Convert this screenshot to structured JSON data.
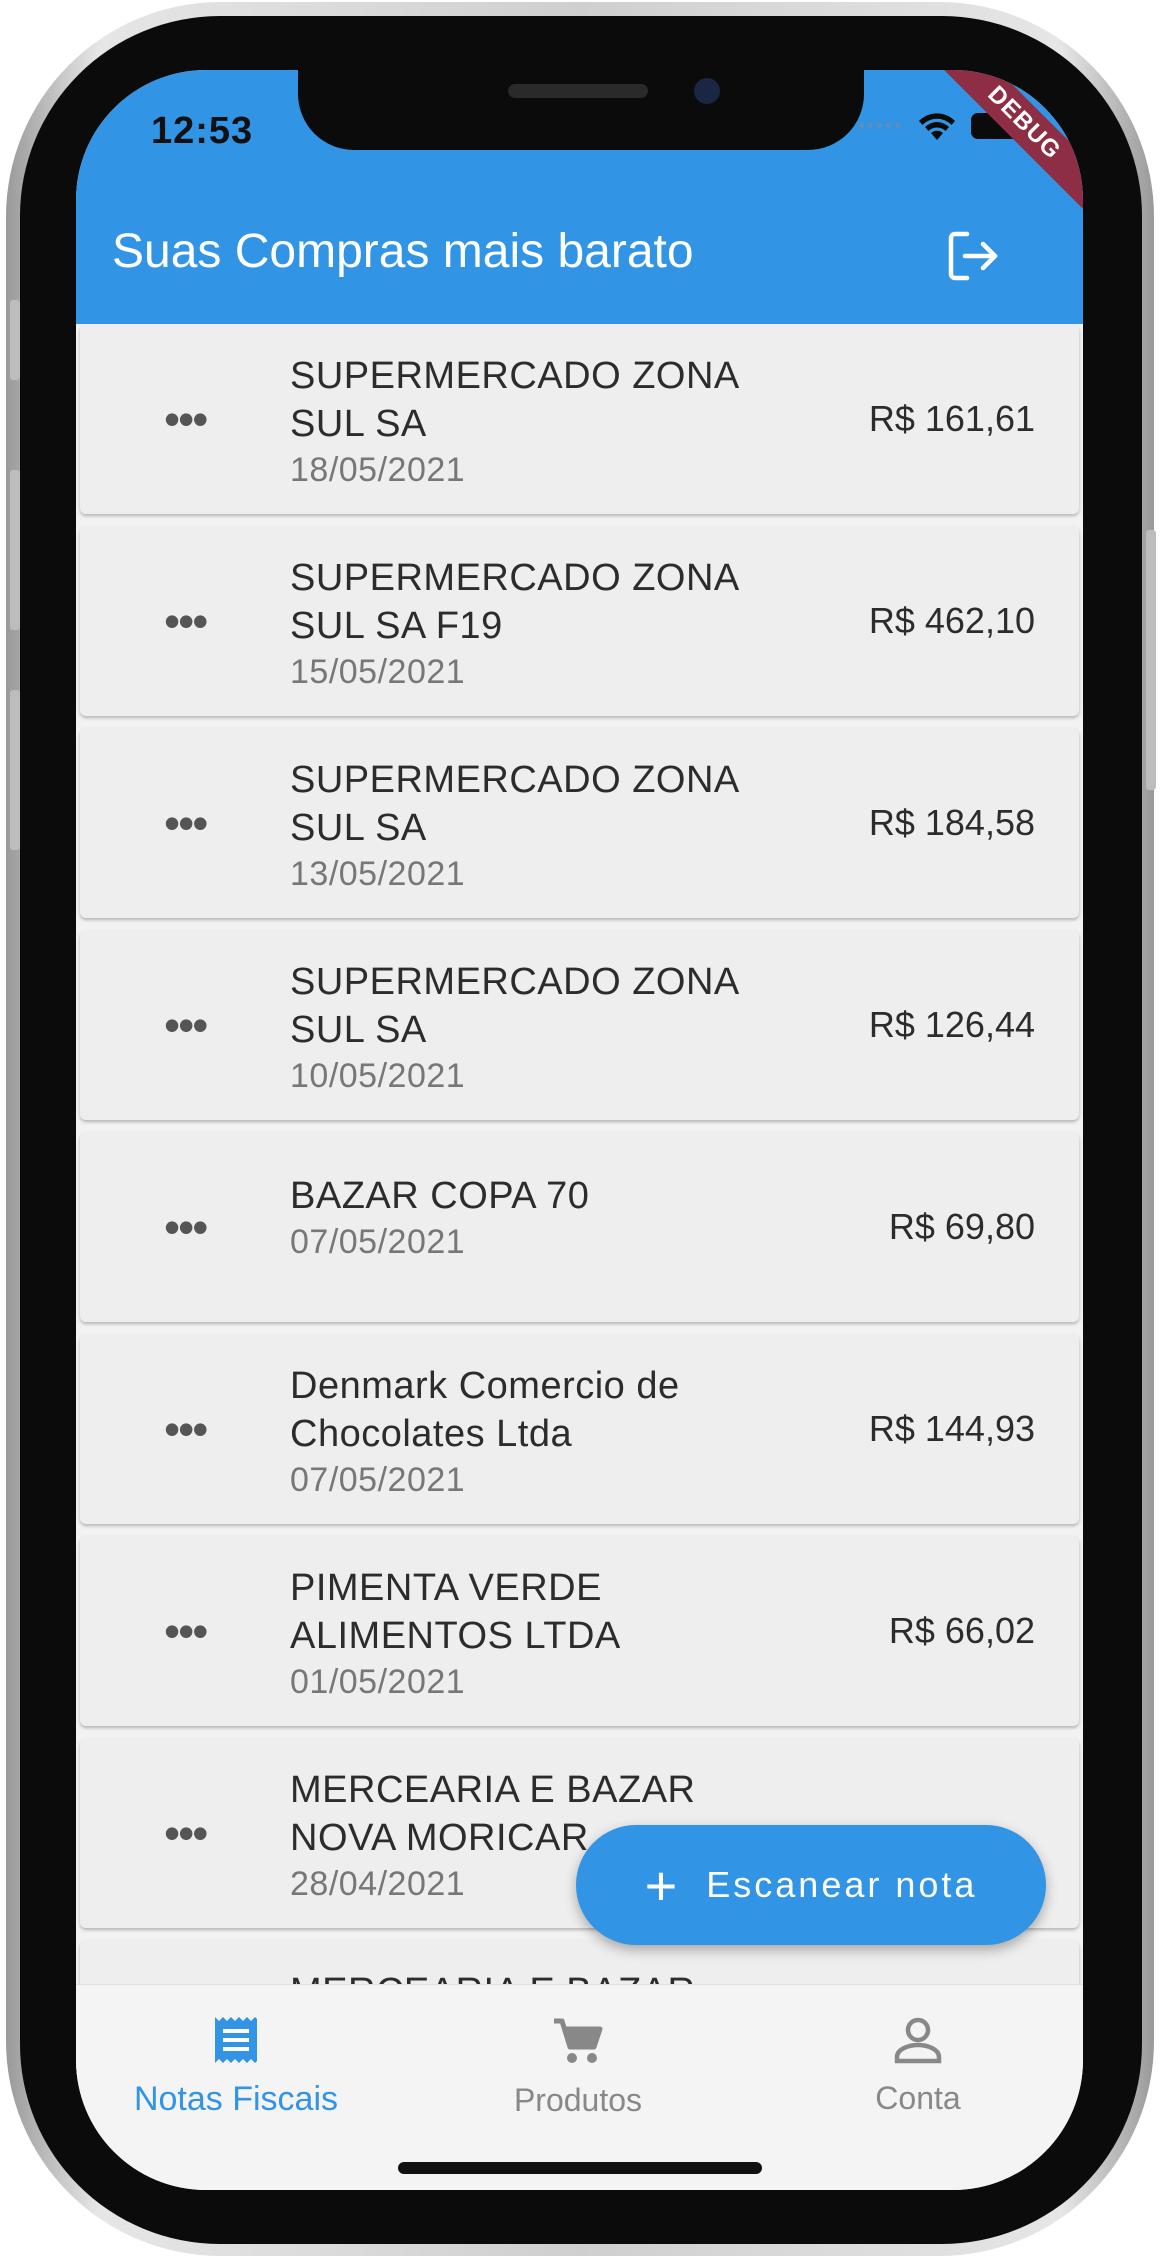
{
  "status_bar": {
    "time": "12:53",
    "debug_label": "DEBUG"
  },
  "app_bar": {
    "title": "Suas Compras mais barato",
    "logout_icon": "logout-icon"
  },
  "receipts": [
    {
      "name": "SUPERMERCADO ZONA SUL SA",
      "date": "18/05/2021",
      "price": "R$ 161,61"
    },
    {
      "name": "SUPERMERCADO ZONA SUL SA F19",
      "date": "15/05/2021",
      "price": "R$ 462,10"
    },
    {
      "name": "SUPERMERCADO ZONA SUL SA",
      "date": "13/05/2021",
      "price": "R$ 184,58"
    },
    {
      "name": "SUPERMERCADO ZONA SUL SA",
      "date": "10/05/2021",
      "price": "R$ 126,44"
    },
    {
      "name": "BAZAR COPA 70",
      "date": "07/05/2021",
      "price": "R$ 69,80"
    },
    {
      "name": "Denmark Comercio de Chocolates Ltda",
      "date": "07/05/2021",
      "price": "R$ 144,93"
    },
    {
      "name": "PIMENTA VERDE ALIMENTOS LTDA",
      "date": "01/05/2021",
      "price": "R$ 66,02"
    },
    {
      "name": "MERCEARIA E BAZAR NOVA MORICAR",
      "date": "28/04/2021",
      "price": ""
    },
    {
      "name": "MERCEARIA E BAZAR",
      "date": "",
      "price": ""
    }
  ],
  "fab": {
    "label": "Escanear nota"
  },
  "bottom_nav": [
    {
      "label": "Notas Fiscais",
      "icon": "receipt-icon",
      "active": true
    },
    {
      "label": "Produtos",
      "icon": "cart-icon",
      "active": false
    },
    {
      "label": "Conta",
      "icon": "person-icon",
      "active": false
    }
  ],
  "colors": {
    "primary": "#3294e4",
    "debug": "#8e2e45"
  }
}
